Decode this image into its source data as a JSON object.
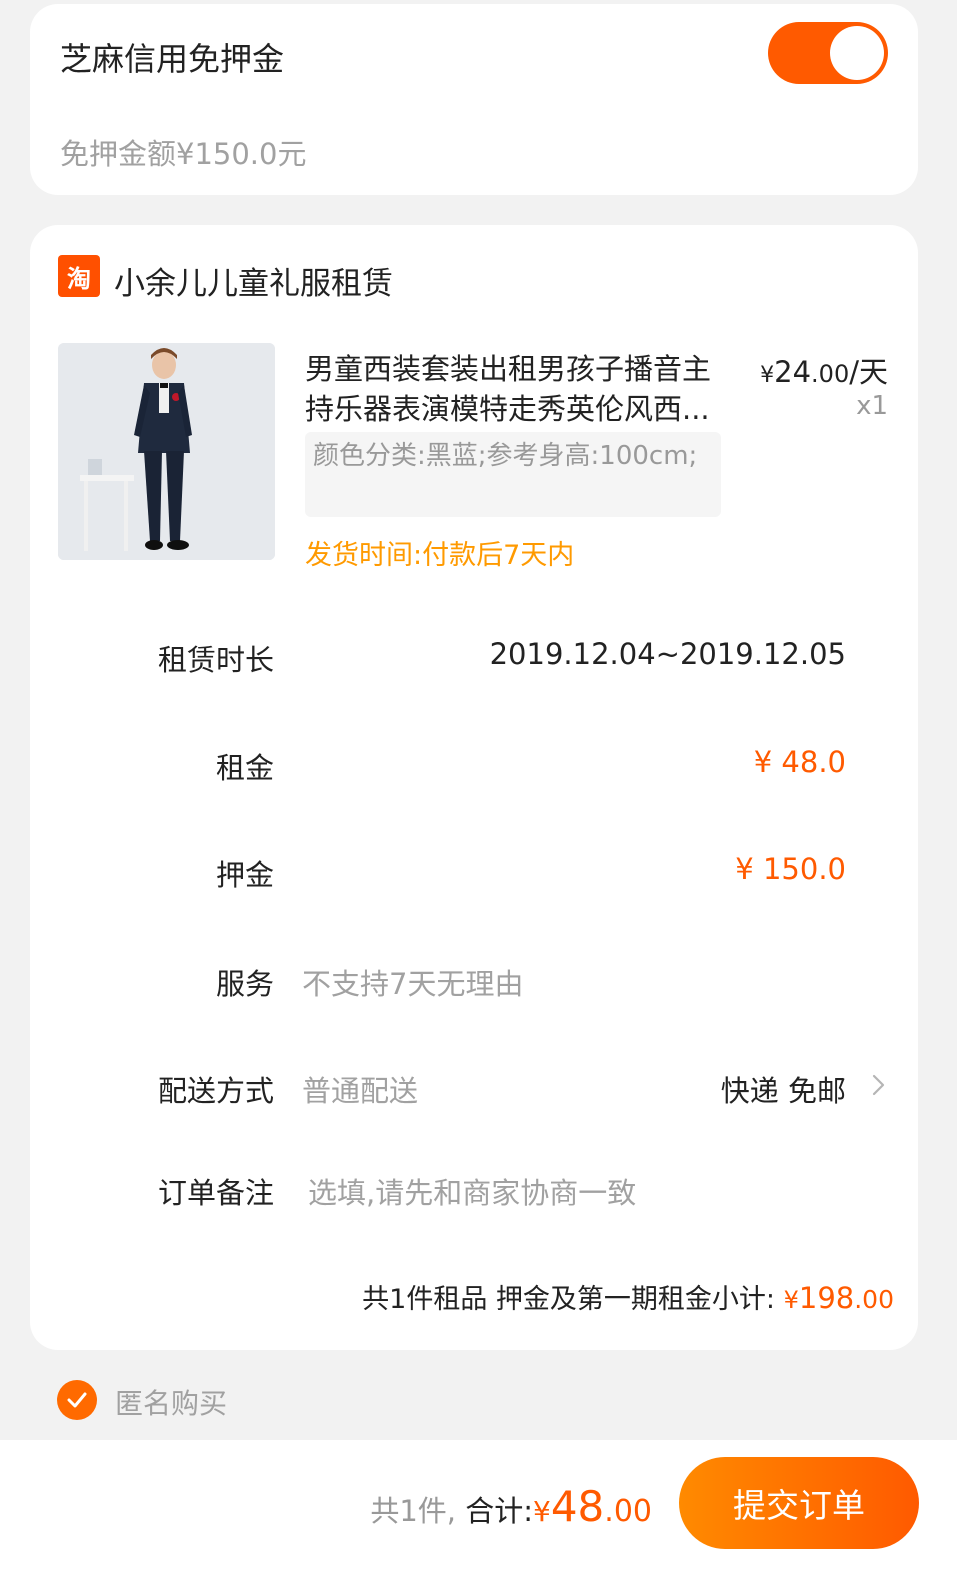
{
  "credit": {
    "title": "芝麻信用免押金",
    "deposit_free": "免押金额¥150.0元",
    "toggle_on": true,
    "accent_color": "#ff5a00"
  },
  "shop": {
    "icon_glyph": "淘",
    "name": "小余儿儿童礼服租赁"
  },
  "product": {
    "title": "男童西装套装出租男孩子播音主持乐器表演模特走秀英伦风西...",
    "price_yen": "¥",
    "price_int": "24",
    "price_dec": ".00",
    "price_unit": "/天",
    "qty": "x1",
    "sku": "颜色分类:黑蓝;参考身高:100cm;",
    "ship_time": "发货时间:付款后7天内"
  },
  "rows": {
    "duration_label": "租赁时长",
    "duration_value": "2019.12.04~2019.12.05",
    "rent_label": "租金",
    "rent_value": "¥ 48.0",
    "deposit_label": "押金",
    "deposit_value": "¥ 150.0",
    "service_label": "服务",
    "service_value": "不支持7天无理由",
    "delivery_label": "配送方式",
    "delivery_value": "普通配送",
    "delivery_option": "快递 免邮",
    "note_label": "订单备注",
    "note_placeholder": "选填,请先和商家协商一致"
  },
  "subtotal": {
    "text": "共1件租品 押金及第一期租金小计: ",
    "yen": "¥",
    "int": "198",
    "dec": ".00"
  },
  "anonymous": {
    "label": "匿名购买",
    "checked": true
  },
  "bottom": {
    "count": "共1件,",
    "total_label": "合计:",
    "yen": "¥",
    "int": "48",
    "dec": ".00",
    "submit_label": "提交订单"
  }
}
